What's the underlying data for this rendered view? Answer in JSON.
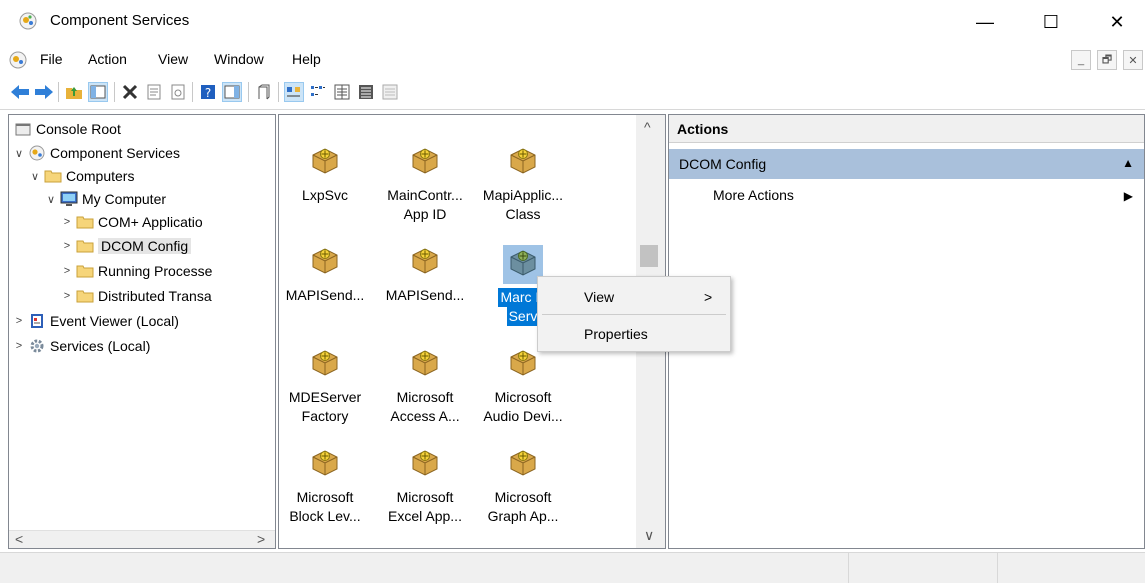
{
  "window": {
    "title": "Component Services",
    "minimize": "—",
    "maximize": "☐",
    "close": "✕"
  },
  "menubar": {
    "items": [
      "File",
      "Action",
      "View",
      "Window",
      "Help"
    ],
    "mdi": [
      "_",
      "🗗",
      "✕"
    ]
  },
  "toolbar": {
    "buttons": [
      "back-icon",
      "forward-icon",
      "up-folder-icon",
      "show-hide-tree-icon",
      "delete-icon",
      "properties-icon",
      "export-icon",
      "help-icon",
      "show-hide-action-pane-icon",
      "new-window-icon",
      "large-icons-view-icon",
      "small-icons-view-icon",
      "list-view-icon",
      "detail-view-icon",
      "configure-icon"
    ]
  },
  "tree": {
    "items": [
      {
        "label": "Console Root"
      },
      {
        "label": "Component Services",
        "chevron": "∨"
      },
      {
        "label": "Computers",
        "chevron": "∨"
      },
      {
        "label": "My Computer",
        "chevron": "∨"
      },
      {
        "label": "COM+ Applicatio",
        "chevron": ">"
      },
      {
        "label": "DCOM Config",
        "chevron": ">"
      },
      {
        "label": "Running Processe",
        "chevron": ">"
      },
      {
        "label": "Distributed Transa",
        "chevron": ">"
      },
      {
        "label": "Event Viewer (Local)",
        "chevron": ">"
      },
      {
        "label": "Services (Local)",
        "chevron": ">"
      }
    ],
    "scroll_left": "<",
    "scroll_right": ">"
  },
  "center": {
    "items": [
      {
        "line1": "LxpSvc",
        "line2": ""
      },
      {
        "line1": "MainContr...",
        "line2": "App ID"
      },
      {
        "line1": "MapiApplic...",
        "line2": "Class"
      },
      {
        "line1": "MAPISend...",
        "line2": ""
      },
      {
        "line1": "MAPISend...",
        "line2": ""
      },
      {
        "line1": "Marc D",
        "line2": "Serv"
      },
      {
        "line1": "MDEServer",
        "line2": "Factory"
      },
      {
        "line1": "Microsoft",
        "line2": "Access A..."
      },
      {
        "line1": "Microsoft",
        "line2": "Audio Devi..."
      },
      {
        "line1": "Microsoft",
        "line2": "Block Lev..."
      },
      {
        "line1": "Microsoft",
        "line2": "Excel App..."
      },
      {
        "line1": "Microsoft",
        "line2": "Graph Ap..."
      }
    ],
    "scroll_up": "^",
    "scroll_down": "∨"
  },
  "actions": {
    "header": "Actions",
    "section": "DCOM Config",
    "section_arrow": "▲",
    "more": "More Actions",
    "more_arrow": "▶"
  },
  "context_menu": {
    "view": "View",
    "view_arrow": ">",
    "properties": "Properties"
  },
  "colors": {
    "accent": "#0078d7",
    "section": "#a9c0db"
  }
}
